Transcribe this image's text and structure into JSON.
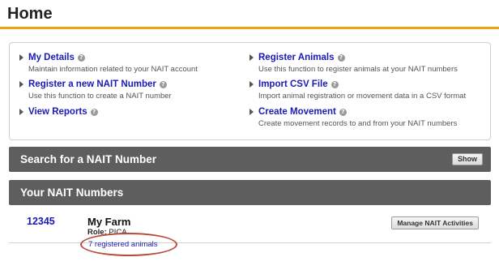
{
  "page": {
    "title": "Home"
  },
  "links": [
    {
      "title": "My Details",
      "description": "Maintain information related to your NAIT account",
      "help": "?"
    },
    {
      "title": "Register a new NAIT Number",
      "description": "Use this function to create a NAIT number",
      "help": "?"
    },
    {
      "title": "View Reports",
      "description": "",
      "help": "?"
    },
    {
      "title": "Register Animals",
      "description": "Use this function to register animals at your NAIT numbers",
      "help": "?"
    },
    {
      "title": "Import CSV File",
      "description": "Import animal registration or movement data in a CSV format",
      "help": "?"
    },
    {
      "title": "Create Movement",
      "description": "Create movement records to and from your NAIT numbers",
      "help": "?"
    }
  ],
  "search_section": {
    "title": "Search for a NAIT Number",
    "button_label": "Show"
  },
  "numbers_section": {
    "title": "Your NAIT Numbers"
  },
  "nait_entry": {
    "number": "12345",
    "farm_name": "My Farm",
    "role_label": "Role:",
    "role_value": "PICA",
    "animals_link": "7 registered animals",
    "manage_button": "Manage NAIT Activities"
  },
  "colors": {
    "accent": "#e8a511",
    "link": "#1a1ab5",
    "bar": "#5e5e5e",
    "highlight": "#b84a3c"
  }
}
